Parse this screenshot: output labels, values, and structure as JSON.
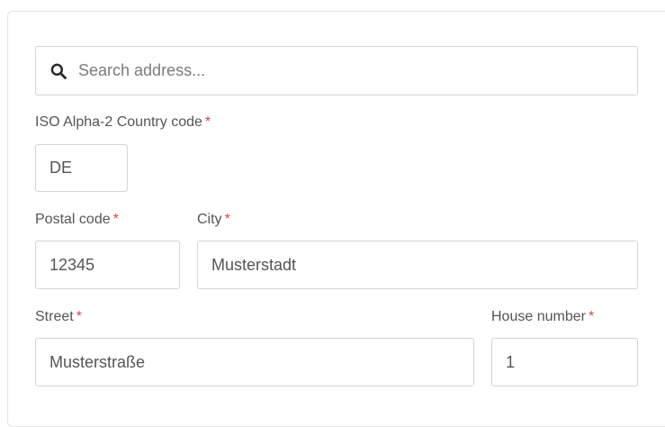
{
  "search": {
    "placeholder": "Search address...",
    "icon": "search-icon"
  },
  "form": {
    "country_code": {
      "label": "ISO Alpha-2 Country code",
      "required_marker": "*",
      "value": "DE"
    },
    "postal_code": {
      "label": "Postal code",
      "required_marker": "*",
      "value": "12345"
    },
    "city": {
      "label": "City",
      "required_marker": "*",
      "value": "Musterstadt"
    },
    "street": {
      "label": "Street",
      "required_marker": "*",
      "value": "Musterstraße"
    },
    "house_number": {
      "label": "House number",
      "required_marker": "*",
      "value": "1"
    }
  },
  "colors": {
    "required_marker": "#c9484f",
    "border": "#d4d4d4",
    "text": "#555555"
  }
}
